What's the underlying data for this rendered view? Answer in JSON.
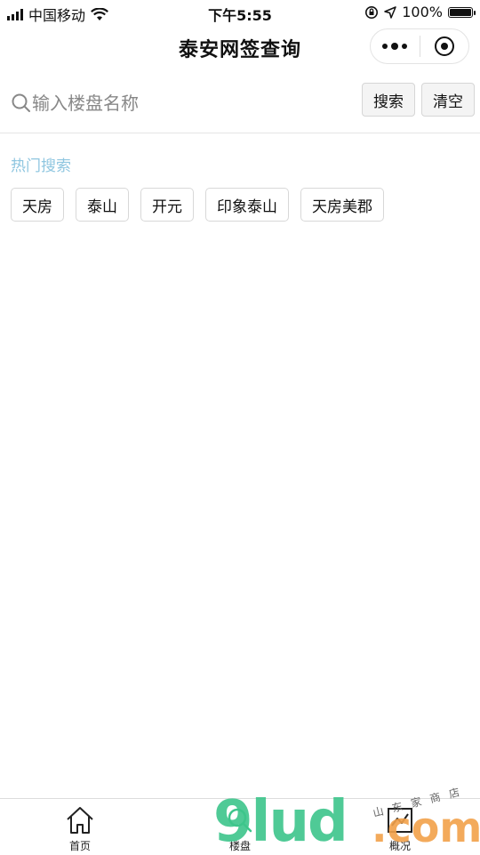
{
  "status_bar": {
    "carrier": "中国移动",
    "time": "下午5:55",
    "battery_text": "100%",
    "battery_level": 1.0
  },
  "nav": {
    "title": "泰安网签查询"
  },
  "search": {
    "placeholder": "输入楼盘名称",
    "value": "",
    "search_button": "搜索",
    "clear_button": "清空"
  },
  "hot": {
    "title": "热门搜索",
    "tags": [
      "天房",
      "泰山",
      "开元",
      "印象泰山",
      "天房美郡"
    ]
  },
  "tabbar": {
    "items": [
      {
        "label": "首页",
        "icon": "home-icon"
      },
      {
        "label": "楼盘",
        "icon": "search-icon"
      },
      {
        "label": "概况",
        "icon": "chart-icon"
      }
    ]
  },
  "watermark": {
    "main": "9lud",
    "suffix": ".com",
    "small": "山东家商店"
  },
  "colors": {
    "hot_title": "#8fc6e0",
    "watermark_green": "#3dc58b",
    "watermark_orange": "#f2a14a"
  }
}
